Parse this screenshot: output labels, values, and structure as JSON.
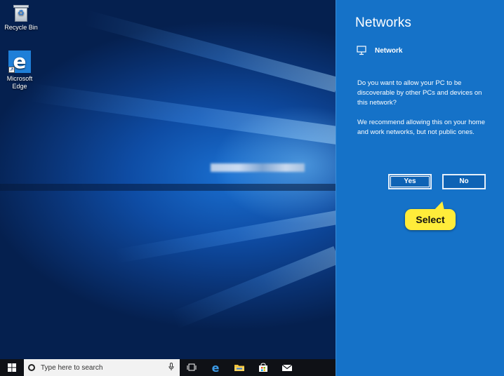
{
  "desktop": {
    "icons": [
      {
        "label": "Recycle Bin",
        "icon": "recycle-bin-icon"
      },
      {
        "label": "Microsoft\nEdge",
        "icon": "edge-icon"
      }
    ]
  },
  "taskbar": {
    "search_placeholder": "Type here to search",
    "icons": [
      "windows-start-icon",
      "search-icon",
      "microphone-icon",
      "task-view-icon",
      "edge-icon",
      "file-explorer-icon",
      "store-icon",
      "mail-icon"
    ]
  },
  "flyout": {
    "title": "Networks",
    "network_label": "Network",
    "question": "Do you want to allow your PC to be discoverable by other PCs and devices on this network?",
    "recommendation": "We recommend allowing this on your home and work networks, but not public ones.",
    "yes_label": "Yes",
    "no_label": "No",
    "background_color": "#1572c8"
  },
  "callout": {
    "text": "Select",
    "color": "#ffec3a"
  }
}
